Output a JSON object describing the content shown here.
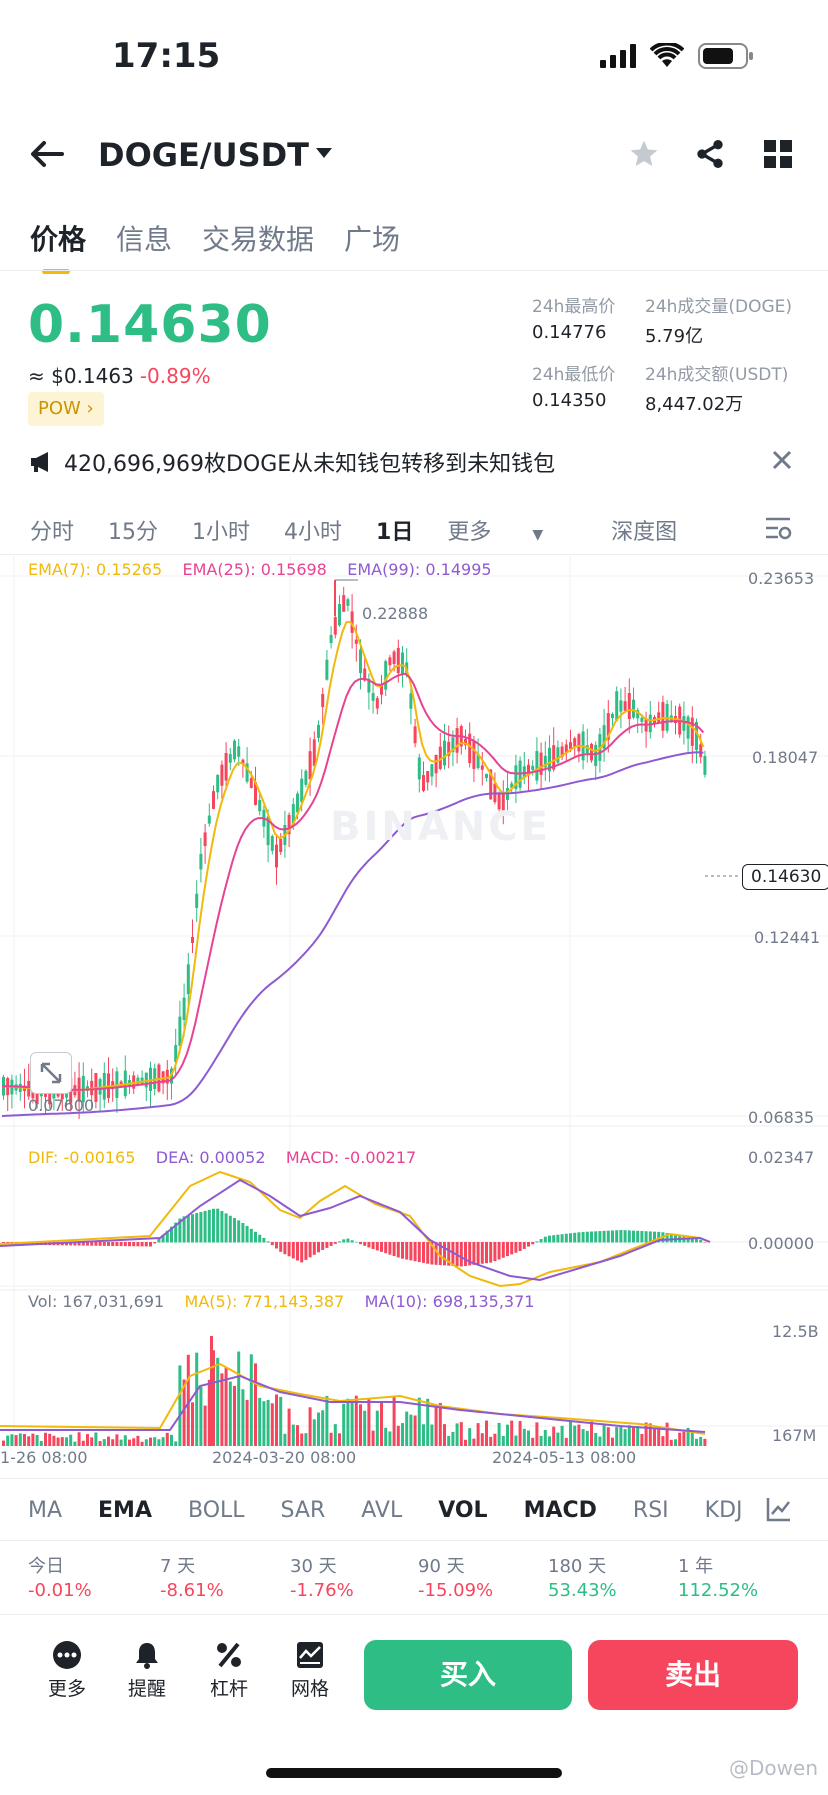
{
  "status": {
    "time": "17:15"
  },
  "header": {
    "pair": "DOGE/USDT"
  },
  "tabs": [
    {
      "label": "价格"
    },
    {
      "label": "信息"
    },
    {
      "label": "交易数据"
    },
    {
      "label": "广场"
    }
  ],
  "price": {
    "last": "0.14630",
    "usd": "≈ $0.1463",
    "change": "-0.89%",
    "tag": "POW"
  },
  "stats": {
    "high_label": "24h最高价",
    "high": "0.14776",
    "vol_label": "24h成交量(DOGE)",
    "vol": "5.79亿",
    "low_label": "24h最低价",
    "low": "0.14350",
    "amount_label": "24h成交额(USDT)",
    "amount": "8,447.02万"
  },
  "notice": {
    "text": "420,696,969枚DOGE从未知钱包转移到未知钱包"
  },
  "intervals": [
    {
      "label": "分时"
    },
    {
      "label": "15分"
    },
    {
      "label": "1小时"
    },
    {
      "label": "4小时"
    },
    {
      "label": "1日"
    },
    {
      "label": "更多"
    },
    {
      "label": "深度图"
    }
  ],
  "chart": {
    "ema7": "EMA(7): 0.15265",
    "ema25": "EMA(25): 0.15698",
    "ema99": "EMA(99): 0.14995",
    "y_ticks": [
      "0.23653",
      "0.18047",
      "0.12441",
      "0.06835"
    ],
    "high_mark": "0.22888",
    "low_mark": "0.07600",
    "current_price": "0.14630",
    "macd_dif": "DIF: -0.00165",
    "macd_dea": "DEA: 0.00052",
    "macd_val": "MACD: -0.00217",
    "macd_ticks": [
      "0.02347",
      "0.00000"
    ],
    "vol": "Vol: 167,031,691",
    "vol_ma5": "MA(5): 771,143,387",
    "vol_ma10": "MA(10): 698,135,371",
    "vol_ticks": [
      "12.5B",
      "167M"
    ],
    "x_ticks": [
      "1-26 08:00",
      "2024-03-20 08:00",
      "2024-05-13 08:00"
    ],
    "watermark": "BINANCE",
    "colors": {
      "up": "#2ebd85",
      "down": "#f6465d",
      "ema7": "#f0b90b",
      "ema25": "#e84393",
      "ema99": "#8e5ad1"
    }
  },
  "indicators": [
    {
      "label": "MA"
    },
    {
      "label": "EMA"
    },
    {
      "label": "BOLL"
    },
    {
      "label": "SAR"
    },
    {
      "label": "AVL"
    },
    {
      "label": "VOL"
    },
    {
      "label": "MACD"
    },
    {
      "label": "RSI"
    },
    {
      "label": "KDJ"
    }
  ],
  "performance": [
    {
      "label": "今日",
      "value": "-0.01%"
    },
    {
      "label": "7 天",
      "value": "-8.61%"
    },
    {
      "label": "30 天",
      "value": "-1.76%"
    },
    {
      "label": "90 天",
      "value": "-15.09%"
    },
    {
      "label": "180 天",
      "value": "53.43%"
    },
    {
      "label": "1 年",
      "value": "112.52%"
    }
  ],
  "bottom": {
    "more": "更多",
    "alert": "提醒",
    "leverage": "杠杆",
    "grid": "网格",
    "buy": "买入",
    "sell": "卖出"
  },
  "footer_watermark": "@Dowen"
}
